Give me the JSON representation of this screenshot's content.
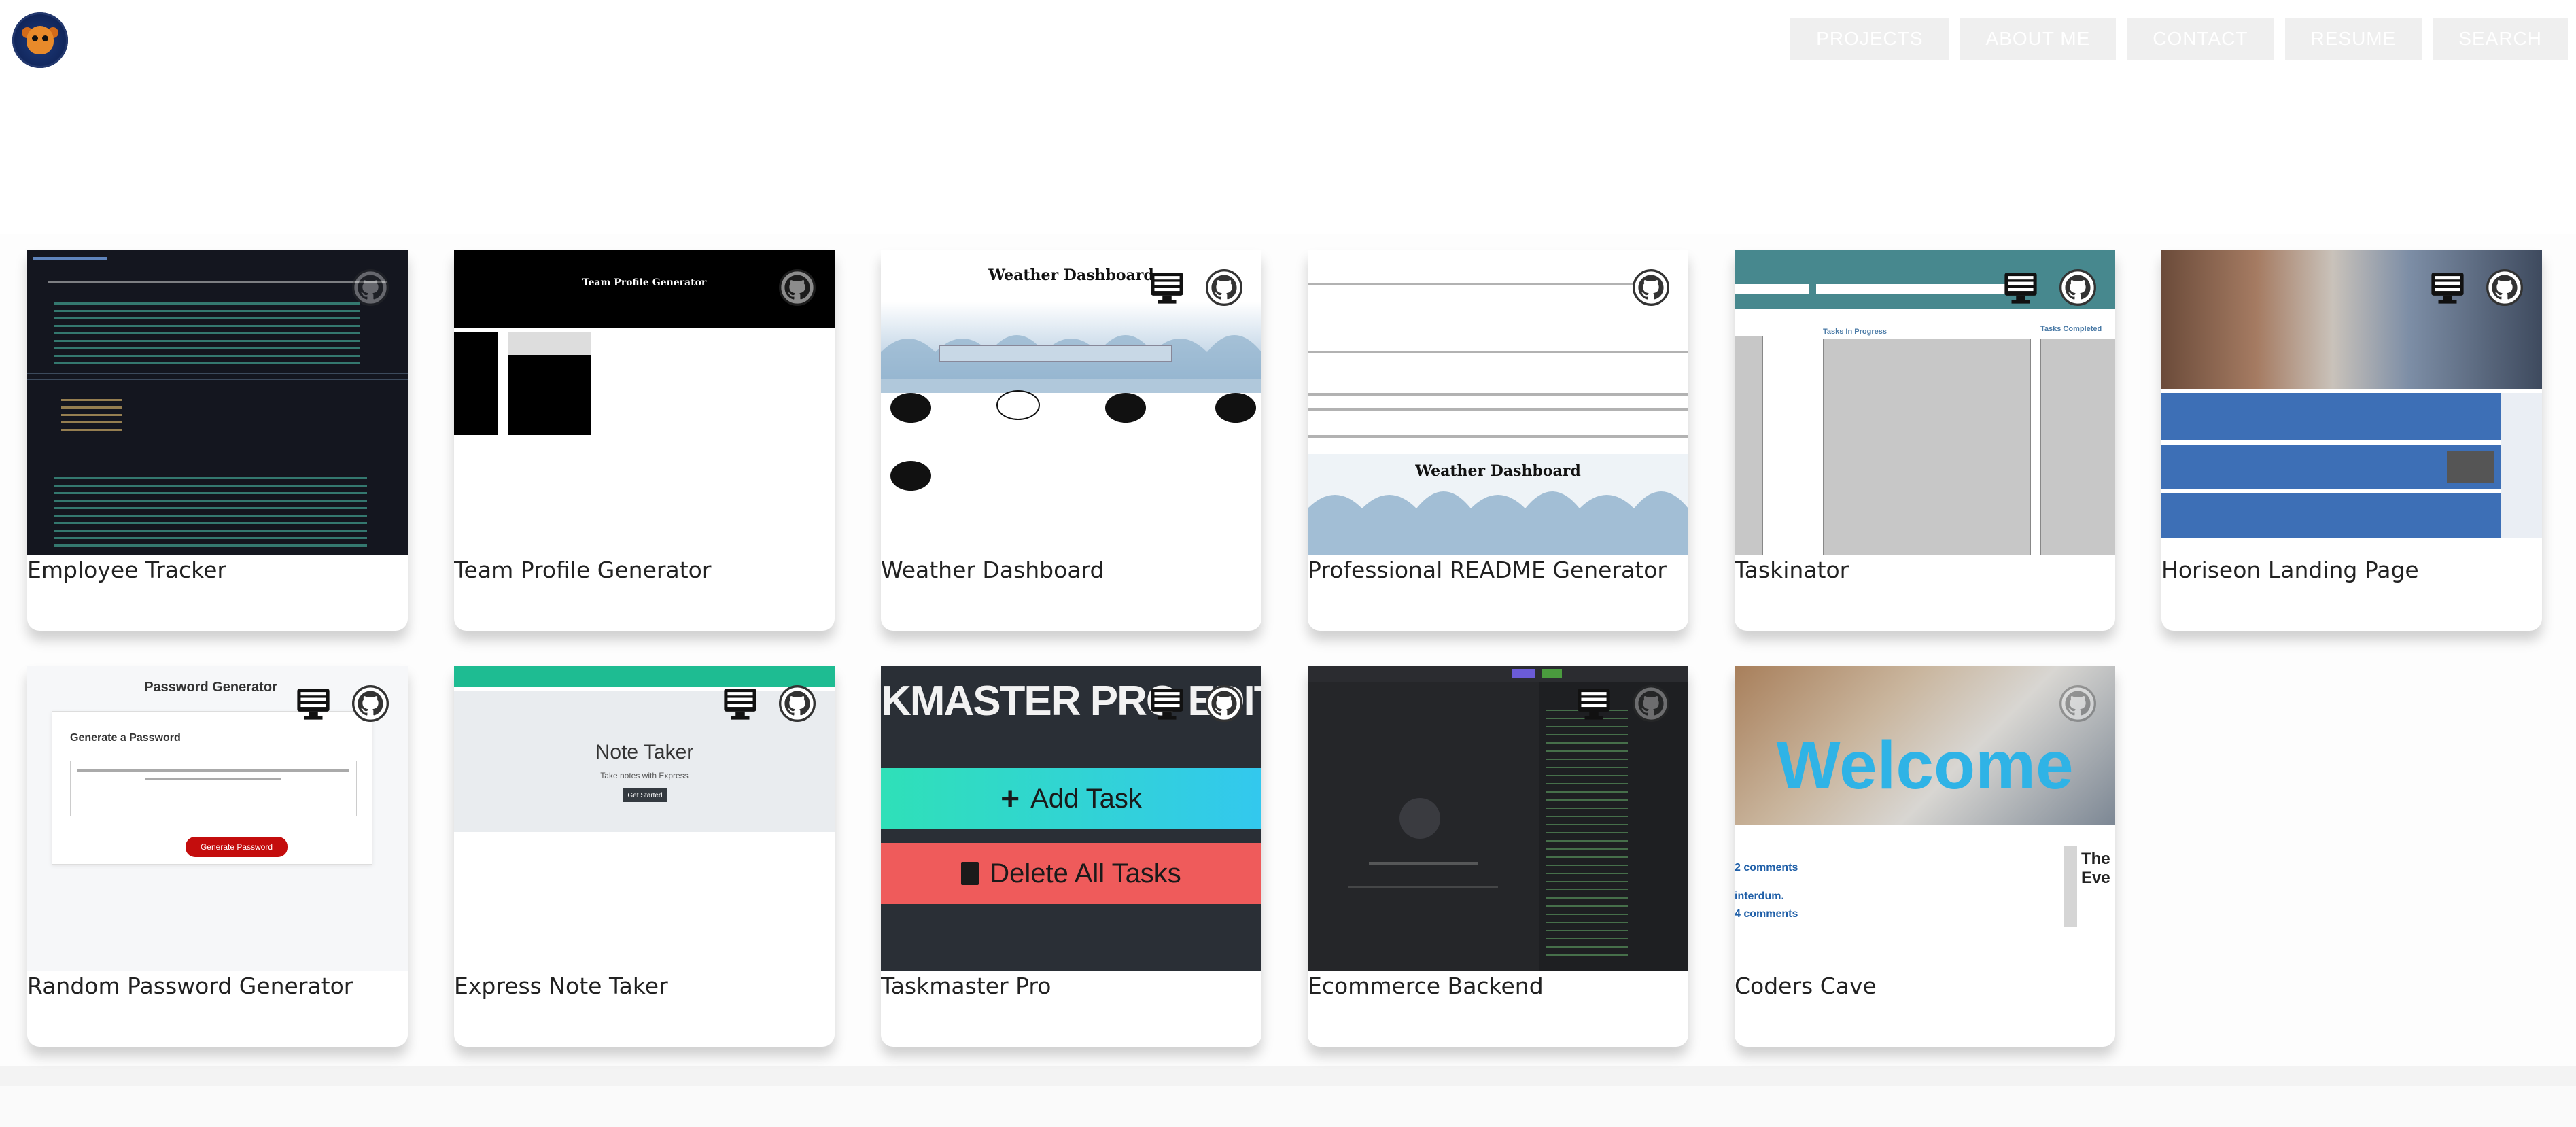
{
  "nav": {
    "items": [
      "PROJECTS",
      "ABOUT ME",
      "CONTACT",
      "RESUME",
      "SEARCH"
    ]
  },
  "projects": [
    {
      "title": "Employee Tracker"
    },
    {
      "title": "Team Profile Generator",
      "thumb_title": "Team Profile Generator"
    },
    {
      "title": "Weather Dashboard",
      "thumb_title": "Weather Dashboard"
    },
    {
      "title": "Professional README Generator",
      "thumb_title": "Weather Dashboard"
    },
    {
      "title": "Taskinator",
      "thumb_label_a": "Tasks In Progress",
      "thumb_label_b": "Tasks Completed"
    },
    {
      "title": "Horiseon Landing Page"
    },
    {
      "title": "Random Password Generator",
      "thumb_title": "Password Generator",
      "thumb_sub": "Generate a Password",
      "thumb_btn": "Generate Password"
    },
    {
      "title": "Express Note Taker",
      "thumb_title": "Note Taker",
      "thumb_sub": "Take notes with Express",
      "thumb_btn": "Get Started"
    },
    {
      "title": "Taskmaster Pro",
      "thumb_header": "KMASTER PRO EDIT",
      "thumb_add": "Add Task",
      "thumb_del": "Delete All Tasks"
    },
    {
      "title": "Ecommerce Backend"
    },
    {
      "title": "Coders Cave",
      "thumb_welcome": "Welcome",
      "thumb_c1": "2 comments",
      "thumb_c2": "interdum.",
      "thumb_c3": "4 comments",
      "thumb_side": "The Eve"
    }
  ],
  "colors": {
    "nav_bg": "#efefef",
    "teal": "#1ebc92",
    "taskmaster_add": "#33d3d6",
    "taskmaster_del": "#ef5b5b",
    "password_btn": "#c40d0d",
    "horiseon_blue": "#3d6fb6"
  }
}
